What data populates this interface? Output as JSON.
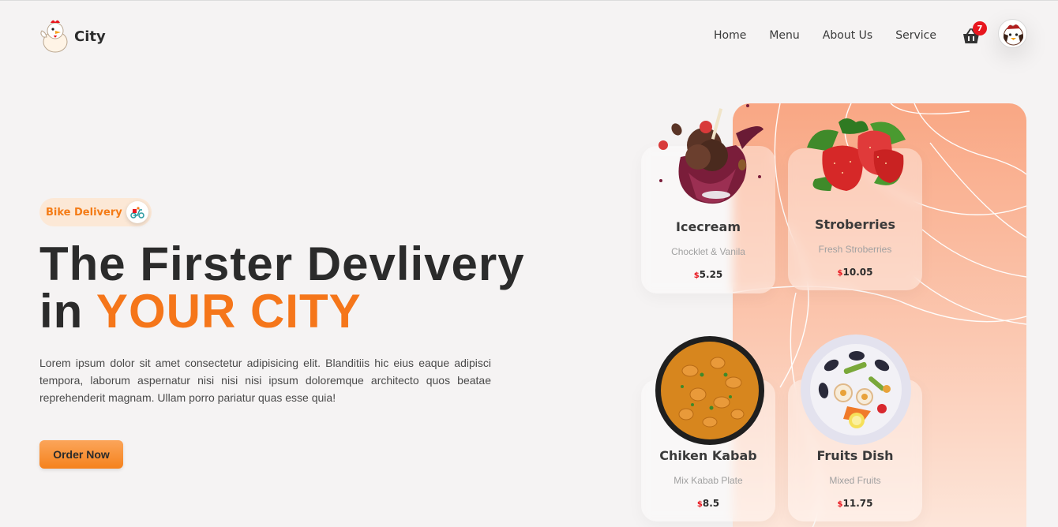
{
  "brand": {
    "name": "City"
  },
  "nav": {
    "items": [
      "Home",
      "Menu",
      "About Us",
      "Service"
    ]
  },
  "cart": {
    "count": "7"
  },
  "hero": {
    "pill_label": "Bike Delivery",
    "headline_line1": "The Firster Devlivery",
    "headline_line2_prefix": "in",
    "headline_line2_accent": "YOUR CITY",
    "description": "Lorem ipsum dolor sit amet consectetur adipisicing elit. Blanditiis hic eius eaque adipisci tempora, laborum aspernatur nisi nisi nisi ipsum doloremque architecto quos beatae reprehenderit magnam. Ullam porro pariatur quas esse quia!",
    "cta_label": "Order Now"
  },
  "menu_cards": [
    {
      "title": "Icecream",
      "subtitle": "Chocklet & Vanila",
      "currency": "$",
      "price": "5.25"
    },
    {
      "title": "Stroberries",
      "subtitle": "Fresh Stroberries",
      "currency": "$",
      "price": "10.05"
    },
    {
      "title": "Chiken Kabab",
      "subtitle": "Mix Kabab Plate",
      "currency": "$",
      "price": "8.5"
    },
    {
      "title": "Fruits Dish",
      "subtitle": "Mixed Fruits",
      "currency": "$",
      "price": "11.75"
    }
  ],
  "colors": {
    "accent": "#f5761a",
    "badge": "#e8161e",
    "panel_top": "#f9a784",
    "background": "#f5f3f3"
  }
}
